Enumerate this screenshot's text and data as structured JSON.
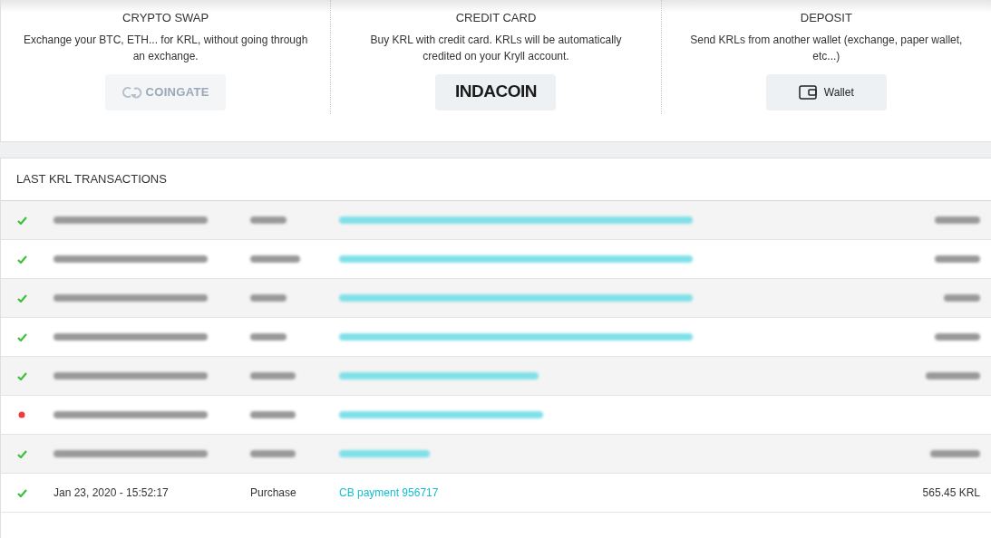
{
  "options": [
    {
      "title": "CRYPTO SWAP",
      "description": "Exchange your BTC, ETH... for KRL, without going through an exchange.",
      "button": {
        "kind": "coingate",
        "label": "COINGATE",
        "disabled": true
      }
    },
    {
      "title": "CREDIT CARD",
      "description": "Buy KRL with credit card. KRLs will be automatically credited on your Kryll account.",
      "button": {
        "kind": "indacoin",
        "label": "INDACOIN",
        "disabled": false
      }
    },
    {
      "title": "DEPOSIT",
      "description": "Send KRLs from another wallet (exchange, paper wallet, etc...)",
      "button": {
        "kind": "wallet",
        "label": "Wallet",
        "disabled": false
      }
    }
  ],
  "transactions": {
    "title": "LAST KRL TRANSACTIONS",
    "rows": [
      {
        "failed": false,
        "blurred": true
      },
      {
        "failed": false,
        "blurred": true
      },
      {
        "failed": false,
        "blurred": true
      },
      {
        "failed": false,
        "blurred": true
      },
      {
        "failed": false,
        "blurred": true
      },
      {
        "failed": true,
        "blurred": true
      },
      {
        "failed": false,
        "blurred": true
      },
      {
        "failed": false,
        "blurred": false,
        "date": "Jan 23, 2020 - 15:52:17",
        "type": "Purchase",
        "reference": "CB payment 956717",
        "amount": "565.45 KRL"
      }
    ]
  }
}
